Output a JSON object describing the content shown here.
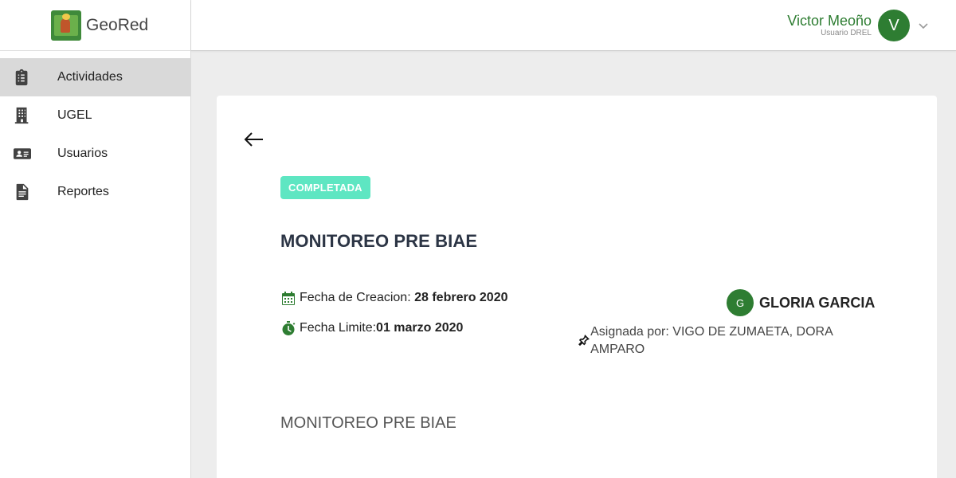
{
  "brand": {
    "name": "GeoRed",
    "logo_icon": "geored-logo"
  },
  "sidebar": {
    "items": [
      {
        "label": "Actividades",
        "icon": "clipboard-list-icon",
        "active": true
      },
      {
        "label": "UGEL",
        "icon": "building-icon",
        "active": false
      },
      {
        "label": "Usuarios",
        "icon": "id-card-icon",
        "active": false
      },
      {
        "label": "Reportes",
        "icon": "document-icon",
        "active": false
      }
    ]
  },
  "header": {
    "user": {
      "name": "Victor Meoño",
      "role": "Usuario DREL",
      "initial": "V"
    }
  },
  "activity": {
    "status": "COMPLETADA",
    "title": "MONITOREO PRE BIAE",
    "created_label": "Fecha de Creacion:",
    "created_value": "28 febrero 2020",
    "deadline_label": "Fecha Limite:",
    "deadline_value": "01 marzo 2020",
    "assignee_initial": "G",
    "assignee_name": "GLORIA GARCIA",
    "assigned_by": "Asignada por: VIGO DE ZUMAETA, DORA AMPARO",
    "description": "MONITOREO PRE BIAE"
  },
  "colors": {
    "accent": "#2e7d32",
    "status_badge": "#5ee6c2",
    "title": "#2c3545",
    "background": "#ededed"
  }
}
